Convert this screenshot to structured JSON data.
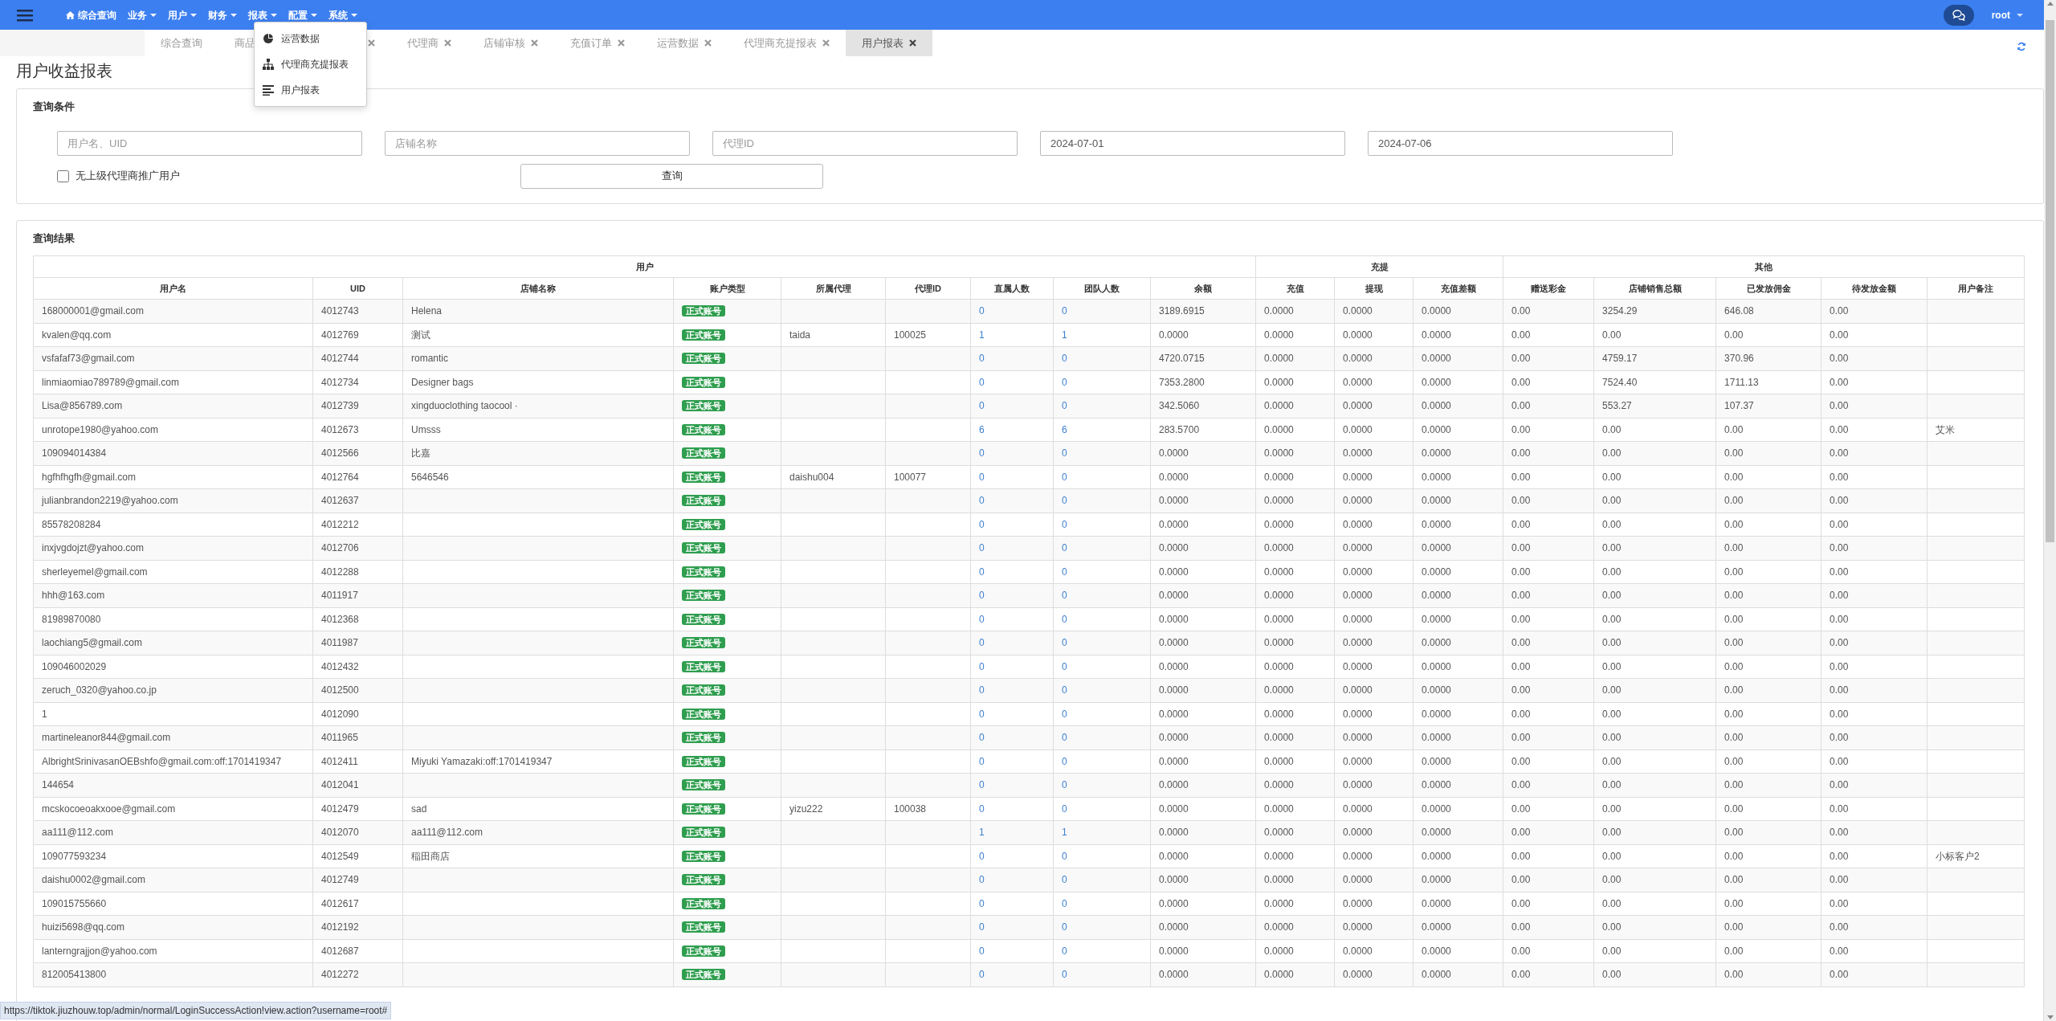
{
  "navbar": {
    "menu": [
      {
        "label": "综合查询",
        "kind": "home"
      },
      {
        "label": "业务",
        "kind": "dropdown"
      },
      {
        "label": "用户",
        "kind": "dropdown"
      },
      {
        "label": "财务",
        "kind": "dropdown"
      },
      {
        "label": "报表",
        "kind": "dropdown"
      },
      {
        "label": "配置",
        "kind": "dropdown"
      },
      {
        "label": "系统",
        "kind": "dropdown"
      }
    ],
    "user": "root"
  },
  "dropdown": {
    "items": [
      {
        "label": "运营数据",
        "kind": "pie"
      },
      {
        "label": "代理商充提报表",
        "kind": "tree"
      },
      {
        "label": "用户报表",
        "kind": "lines"
      }
    ]
  },
  "tabs": [
    {
      "label": "综合查询",
      "closable": false,
      "selected": false
    },
    {
      "label": "商品",
      "closable": false,
      "selected": false
    },
    {
      "closable": true,
      "selected": false
    },
    {
      "label": "代理商",
      "closable": true,
      "selected": false
    },
    {
      "label": "店铺审核",
      "closable": true,
      "selected": false
    },
    {
      "label": "充值订单",
      "closable": true,
      "selected": false
    },
    {
      "label": "运营数据",
      "closable": true,
      "selected": false
    },
    {
      "label": "代理商充提报表",
      "closable": true,
      "selected": false
    },
    {
      "label": "用户报表",
      "closable": true,
      "selected": true
    }
  ],
  "page_title": "用户收益报表",
  "query": {
    "title": "查询条件",
    "fields": [
      {
        "placeholder": "用户名、UID"
      },
      {
        "placeholder": "店铺名称"
      },
      {
        "placeholder": "代理ID"
      },
      {
        "value": "2024-07-01"
      },
      {
        "value": "2024-07-06"
      }
    ],
    "checkbox": {
      "label": "无上级代理商推广用户",
      "checked": false
    },
    "button": "查询"
  },
  "results": {
    "title": "查询结果",
    "groups": [
      {
        "label": "用户"
      },
      {
        "label": "充提"
      },
      {
        "label": "其他"
      }
    ],
    "columns": [
      {
        "label": "用户名",
        "kind": "text"
      },
      {
        "label": "UID",
        "kind": "text"
      },
      {
        "label": "店铺名称",
        "kind": "text"
      },
      {
        "label": "账户类型",
        "kind": "badge"
      },
      {
        "label": "所属代理",
        "kind": "text"
      },
      {
        "label": "代理ID",
        "kind": "text"
      },
      {
        "label": "直属人数",
        "kind": "link"
      },
      {
        "label": "团队人数",
        "kind": "link"
      },
      {
        "label": "余额",
        "kind": "text"
      },
      {
        "label": "充值",
        "kind": "text"
      },
      {
        "label": "提现",
        "kind": "text"
      },
      {
        "label": "充值差额",
        "kind": "text"
      },
      {
        "label": "赠送彩金",
        "kind": "text"
      },
      {
        "label": "店铺销售总额",
        "kind": "text"
      },
      {
        "label": "已发放佣金",
        "kind": "text"
      },
      {
        "label": "待发放金额",
        "kind": "text"
      },
      {
        "label": "用户备注",
        "kind": "text"
      }
    ],
    "rows": [
      [
        "168000001@gmail.com",
        "4012743",
        "Helena",
        "正式账号",
        "",
        "",
        "0",
        "0",
        "3189.6915",
        "0.0000",
        "0.0000",
        "0.0000",
        "0.00",
        "3254.29",
        "646.08",
        "0.00",
        ""
      ],
      [
        "kvalen@qq.com",
        "4012769",
        "测试",
        "正式账号",
        "taida",
        "100025",
        "1",
        "1",
        "0.0000",
        "0.0000",
        "0.0000",
        "0.0000",
        "0.00",
        "0.00",
        "0.00",
        "0.00",
        ""
      ],
      [
        "vsfafaf73@gmail.com",
        "4012744",
        "romantic",
        "正式账号",
        "",
        "",
        "0",
        "0",
        "4720.0715",
        "0.0000",
        "0.0000",
        "0.0000",
        "0.00",
        "4759.17",
        "370.96",
        "0.00",
        ""
      ],
      [
        "linmiaomiao789789@gmail.com",
        "4012734",
        "Designer bags",
        "正式账号",
        "",
        "",
        "0",
        "0",
        "7353.2800",
        "0.0000",
        "0.0000",
        "0.0000",
        "0.00",
        "7524.40",
        "1711.13",
        "0.00",
        ""
      ],
      [
        "Lisa@856789.com",
        "4012739",
        "xingduoclothing taocool ·",
        "正式账号",
        "",
        "",
        "0",
        "0",
        "342.5060",
        "0.0000",
        "0.0000",
        "0.0000",
        "0.00",
        "553.27",
        "107.37",
        "0.00",
        ""
      ],
      [
        "unrotope1980@yahoo.com",
        "4012673",
        "Umsss",
        "正式账号",
        "",
        "",
        "6",
        "6",
        "283.5700",
        "0.0000",
        "0.0000",
        "0.0000",
        "0.00",
        "0.00",
        "0.00",
        "0.00",
        "艾米"
      ],
      [
        "109094014384",
        "4012566",
        "比嘉",
        "正式账号",
        "",
        "",
        "0",
        "0",
        "0.0000",
        "0.0000",
        "0.0000",
        "0.0000",
        "0.00",
        "0.00",
        "0.00",
        "0.00",
        ""
      ],
      [
        "hgfhfhgfh@gmail.com",
        "4012764",
        "5646546",
        "正式账号",
        "daishu004",
        "100077",
        "0",
        "0",
        "0.0000",
        "0.0000",
        "0.0000",
        "0.0000",
        "0.00",
        "0.00",
        "0.00",
        "0.00",
        ""
      ],
      [
        "julianbrandon2219@yahoo.com",
        "4012637",
        "",
        "正式账号",
        "",
        "",
        "0",
        "0",
        "0.0000",
        "0.0000",
        "0.0000",
        "0.0000",
        "0.00",
        "0.00",
        "0.00",
        "0.00",
        ""
      ],
      [
        "85578208284",
        "4012212",
        "",
        "正式账号",
        "",
        "",
        "0",
        "0",
        "0.0000",
        "0.0000",
        "0.0000",
        "0.0000",
        "0.00",
        "0.00",
        "0.00",
        "0.00",
        ""
      ],
      [
        "inxjvgdojzt@yahoo.com",
        "4012706",
        "",
        "正式账号",
        "",
        "",
        "0",
        "0",
        "0.0000",
        "0.0000",
        "0.0000",
        "0.0000",
        "0.00",
        "0.00",
        "0.00",
        "0.00",
        ""
      ],
      [
        "sherleyemel@gmail.com",
        "4012288",
        "",
        "正式账号",
        "",
        "",
        "0",
        "0",
        "0.0000",
        "0.0000",
        "0.0000",
        "0.0000",
        "0.00",
        "0.00",
        "0.00",
        "0.00",
        ""
      ],
      [
        "hhh@163.com",
        "4011917",
        "",
        "正式账号",
        "",
        "",
        "0",
        "0",
        "0.0000",
        "0.0000",
        "0.0000",
        "0.0000",
        "0.00",
        "0.00",
        "0.00",
        "0.00",
        ""
      ],
      [
        "81989870080",
        "4012368",
        "",
        "正式账号",
        "",
        "",
        "0",
        "0",
        "0.0000",
        "0.0000",
        "0.0000",
        "0.0000",
        "0.00",
        "0.00",
        "0.00",
        "0.00",
        ""
      ],
      [
        "laochiang5@gmail.com",
        "4011987",
        "",
        "正式账号",
        "",
        "",
        "0",
        "0",
        "0.0000",
        "0.0000",
        "0.0000",
        "0.0000",
        "0.00",
        "0.00",
        "0.00",
        "0.00",
        ""
      ],
      [
        "109046002029",
        "4012432",
        "",
        "正式账号",
        "",
        "",
        "0",
        "0",
        "0.0000",
        "0.0000",
        "0.0000",
        "0.0000",
        "0.00",
        "0.00",
        "0.00",
        "0.00",
        ""
      ],
      [
        "zeruch_0320@yahoo.co.jp",
        "4012500",
        "",
        "正式账号",
        "",
        "",
        "0",
        "0",
        "0.0000",
        "0.0000",
        "0.0000",
        "0.0000",
        "0.00",
        "0.00",
        "0.00",
        "0.00",
        ""
      ],
      [
        "1",
        "4012090",
        "",
        "正式账号",
        "",
        "",
        "0",
        "0",
        "0.0000",
        "0.0000",
        "0.0000",
        "0.0000",
        "0.00",
        "0.00",
        "0.00",
        "0.00",
        ""
      ],
      [
        "martineleanor844@gmail.com",
        "4011965",
        "",
        "正式账号",
        "",
        "",
        "0",
        "0",
        "0.0000",
        "0.0000",
        "0.0000",
        "0.0000",
        "0.00",
        "0.00",
        "0.00",
        "0.00",
        ""
      ],
      [
        "AlbrightSrinivasanOEBshfo@gmail.com:off:1701419347",
        "4012411",
        "Miyuki Yamazaki:off:1701419347",
        "正式账号",
        "",
        "",
        "0",
        "0",
        "0.0000",
        "0.0000",
        "0.0000",
        "0.0000",
        "0.00",
        "0.00",
        "0.00",
        "0.00",
        ""
      ],
      [
        "144654",
        "4012041",
        "",
        "正式账号",
        "",
        "",
        "0",
        "0",
        "0.0000",
        "0.0000",
        "0.0000",
        "0.0000",
        "0.00",
        "0.00",
        "0.00",
        "0.00",
        ""
      ],
      [
        "mcskocoeoakxooe@gmail.com",
        "4012479",
        "sad",
        "正式账号",
        "yizu222",
        "100038",
        "0",
        "0",
        "0.0000",
        "0.0000",
        "0.0000",
        "0.0000",
        "0.00",
        "0.00",
        "0.00",
        "0.00",
        ""
      ],
      [
        "aa111@112.com",
        "4012070",
        "aa111@112.com",
        "正式账号",
        "",
        "",
        "1",
        "1",
        "0.0000",
        "0.0000",
        "0.0000",
        "0.0000",
        "0.00",
        "0.00",
        "0.00",
        "0.00",
        ""
      ],
      [
        "109077593234",
        "4012549",
        "稲田商店",
        "正式账号",
        "",
        "",
        "0",
        "0",
        "0.0000",
        "0.0000",
        "0.0000",
        "0.0000",
        "0.00",
        "0.00",
        "0.00",
        "0.00",
        "小标客户2"
      ],
      [
        "daishu0002@gmail.com",
        "4012749",
        "",
        "正式账号",
        "",
        "",
        "0",
        "0",
        "0.0000",
        "0.0000",
        "0.0000",
        "0.0000",
        "0.00",
        "0.00",
        "0.00",
        "0.00",
        ""
      ],
      [
        "109015755660",
        "4012617",
        "",
        "正式账号",
        "",
        "",
        "0",
        "0",
        "0.0000",
        "0.0000",
        "0.0000",
        "0.0000",
        "0.00",
        "0.00",
        "0.00",
        "0.00",
        ""
      ],
      [
        "huizi5698@qq.com",
        "4012192",
        "",
        "正式账号",
        "",
        "",
        "0",
        "0",
        "0.0000",
        "0.0000",
        "0.0000",
        "0.0000",
        "0.00",
        "0.00",
        "0.00",
        "0.00",
        ""
      ],
      [
        "lanterngrajjon@yahoo.com",
        "4012687",
        "",
        "正式账号",
        "",
        "",
        "0",
        "0",
        "0.0000",
        "0.0000",
        "0.0000",
        "0.0000",
        "0.00",
        "0.00",
        "0.00",
        "0.00",
        ""
      ],
      [
        "812005413800",
        "4012272",
        "",
        "正式账号",
        "",
        "",
        "0",
        "0",
        "0.0000",
        "0.0000",
        "0.0000",
        "0.0000",
        "0.00",
        "0.00",
        "0.00",
        "0.00",
        ""
      ]
    ]
  },
  "status_bar": "https://tiktok.jiuzhouw.top/admin/normal/LoginSuccessAction!view.action?username=root#"
}
